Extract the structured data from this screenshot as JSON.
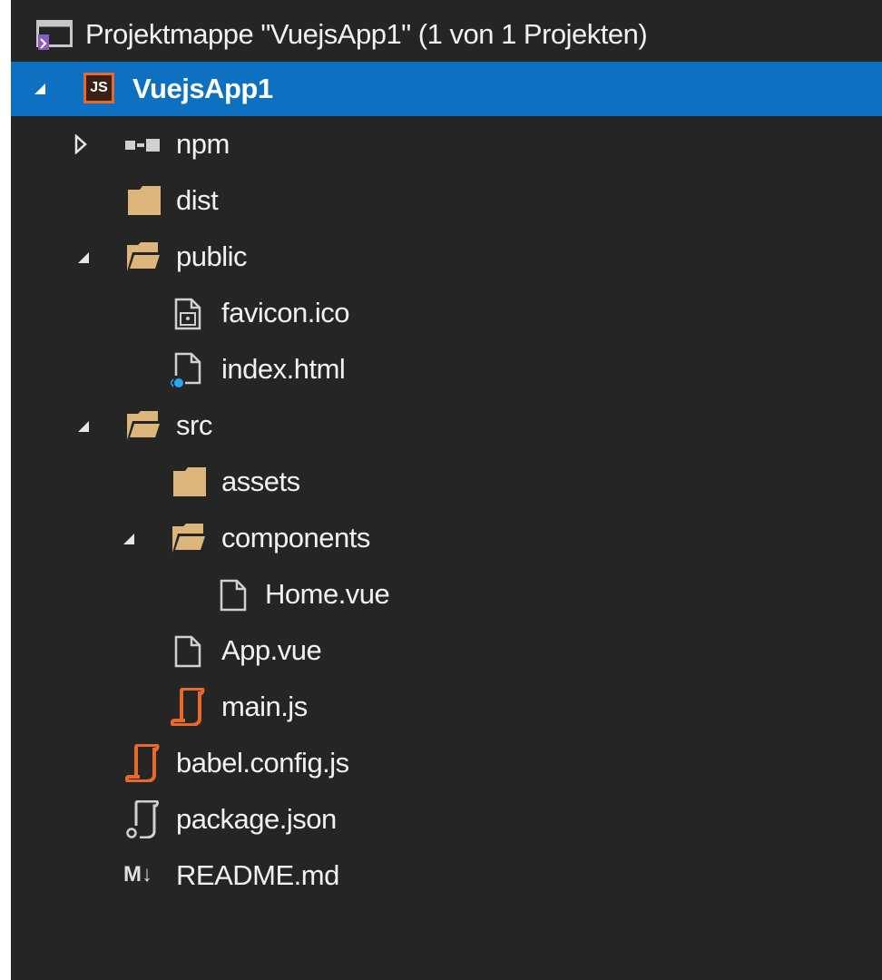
{
  "solution_explorer": {
    "header": {
      "title": "Projektmappe \"VuejsApp1\" (1 von 1 Projekten)"
    },
    "project": {
      "name": "VuejsApp1",
      "icon_text": "JS"
    },
    "items": {
      "npm": "npm",
      "dist": "dist",
      "public": "public",
      "favicon": "favicon.ico",
      "index_html": "index.html",
      "src": "src",
      "assets": "assets",
      "components": "components",
      "home_vue": "Home.vue",
      "app_vue": "App.vue",
      "main_js": "main.js",
      "babel_config": "babel.config.js",
      "package_json": "package.json",
      "readme_icon_text": "M↓",
      "readme": "README.md"
    },
    "colors": {
      "background": "#252526",
      "selection": "#0e70c0",
      "text": "#f1f1f1",
      "folder": "#dcb67a",
      "js_orange": "#e8692c",
      "vs_purple": "#865fc5"
    }
  }
}
